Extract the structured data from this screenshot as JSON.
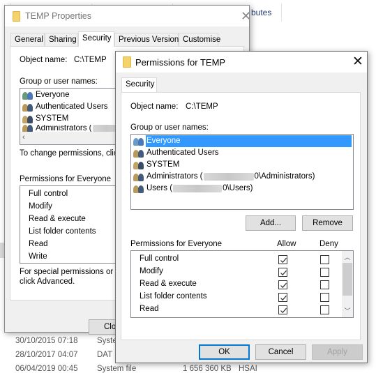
{
  "background": {
    "attributes_header_fragment": "butes",
    "rows": [
      {
        "date": "30/10/2015 07:18",
        "type": "Syste"
      },
      {
        "date": "28/10/2017 04:07",
        "type": "DAT"
      },
      {
        "date": "06/04/2019 00:45",
        "type": "System file",
        "size": "1 656 360 KB",
        "attributes": "HSAI"
      }
    ]
  },
  "properties": {
    "title": "TEMP Properties",
    "tabs": [
      "General",
      "Sharing",
      "Security",
      "Previous Versions",
      "Customise"
    ],
    "active_tab": "Security",
    "object_name_label": "Object name:",
    "object_name_value": "C:\\TEMP",
    "group_label": "Group or user names:",
    "users": [
      "Everyone",
      "Authenticated Users",
      "SYSTEM",
      "Administrators ("
    ],
    "change_hint": "To change permissions, click",
    "permissions_label": "Permissions for Everyone",
    "permissions": [
      "Full control",
      "Modify",
      "Read & execute",
      "List folder contents",
      "Read",
      "Write"
    ],
    "special_hint_line1": "For special permissions or adv",
    "special_hint_line2": "click Advanced.",
    "close_label": "Clos"
  },
  "permissions_dialog": {
    "title": "Permissions for TEMP",
    "tab": "Security",
    "object_name_label": "Object name:",
    "object_name_value": "C:\\TEMP",
    "group_label": "Group or user names:",
    "users": [
      {
        "name": "Everyone",
        "selected": true
      },
      {
        "name": "Authenticated Users",
        "selected": false
      },
      {
        "name": "SYSTEM",
        "selected": false
      },
      {
        "name_prefix": "Administrators (",
        "name_suffix": "0\\Administrators)",
        "redacted": true,
        "selected": false
      },
      {
        "name_prefix": "Users (",
        "name_suffix": "0\\Users)",
        "redacted": true,
        "selected": false
      }
    ],
    "add_label": "Add...",
    "remove_label": "Remove",
    "permissions_label": "Permissions for Everyone",
    "allow_label": "Allow",
    "deny_label": "Deny",
    "permissions": [
      {
        "name": "Full control",
        "allow": true,
        "deny": false
      },
      {
        "name": "Modify",
        "allow": true,
        "deny": false
      },
      {
        "name": "Read & execute",
        "allow": true,
        "deny": false
      },
      {
        "name": "List folder contents",
        "allow": true,
        "deny": false
      },
      {
        "name": "Read",
        "allow": true,
        "deny": false
      }
    ],
    "ok_label": "OK",
    "cancel_label": "Cancel",
    "apply_label": "Apply"
  }
}
